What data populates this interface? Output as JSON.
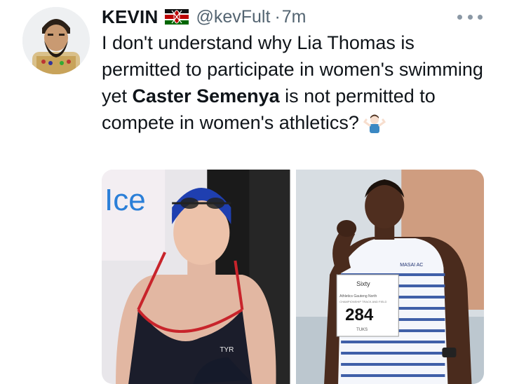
{
  "tweet": {
    "display_name": "KEVIN",
    "handle": "@kevFult",
    "separator": "·",
    "time": "7m",
    "text_line1": "I don't understand why Lia Thomas is permitted to participate in women's swimming yet ",
    "text_bold": "Caster Semenya",
    "text_line2": " is not permitted to compete in women's athletics?",
    "emoji": "person-shrugging"
  },
  "media": {
    "left_image_text": {
      "pool_letters": "Ice",
      "brand": "TYR"
    },
    "right_image_text": {
      "brand": "MASAI AC",
      "bib_top": "Sixty",
      "bib_sponsor": "Athletics Gauteng North",
      "bib_sub": "CHAMPIONSHIP TRACK AND FIELD",
      "bib_number": "284",
      "bib_bottom": "TUKS"
    }
  },
  "colors": {
    "handle": "#536471",
    "text": "#0f1419",
    "background": "#ffffff"
  }
}
